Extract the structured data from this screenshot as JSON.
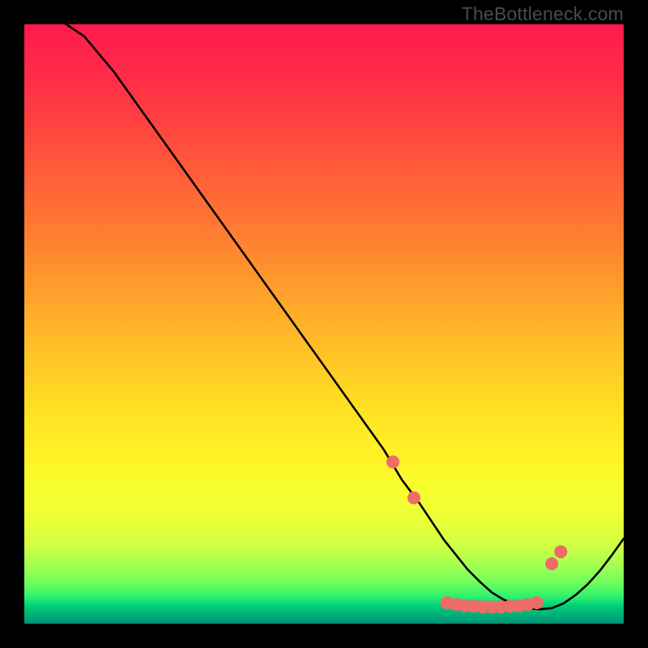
{
  "attribution": "TheBottleneck.com",
  "chart_data": {
    "type": "line",
    "title": "",
    "xlabel": "",
    "ylabel": "",
    "xlim": [
      0,
      100
    ],
    "ylim": [
      0,
      100
    ],
    "series": [
      {
        "name": "curve",
        "x": [
          1,
          7,
          10,
          15,
          20,
          25,
          30,
          35,
          40,
          45,
          50,
          55,
          60,
          63,
          66,
          68,
          70,
          72,
          74,
          76,
          78,
          80,
          82,
          84,
          86,
          88,
          90,
          92,
          94,
          96,
          98,
          100
        ],
        "y": [
          104,
          100,
          98,
          92,
          85,
          78,
          71,
          64,
          57,
          50,
          43,
          36,
          29,
          24,
          20,
          17,
          14,
          11.5,
          9,
          7,
          5.2,
          4,
          3.2,
          2.6,
          2.4,
          2.6,
          3.4,
          4.8,
          6.6,
          8.8,
          11.4,
          14.2
        ]
      }
    ],
    "markers": {
      "name": "highlight-dots",
      "color": "#ef6b66",
      "points_x": [
        61.5,
        65,
        70.5,
        72,
        73.5,
        75,
        76.5,
        78,
        79.5,
        81,
        82.5,
        84,
        85.5,
        88,
        89.5
      ],
      "points_y": [
        27,
        21,
        3.5,
        3.2,
        3,
        2.9,
        2.8,
        2.8,
        2.8,
        2.9,
        3,
        3.2,
        3.5,
        10,
        12
      ]
    }
  }
}
